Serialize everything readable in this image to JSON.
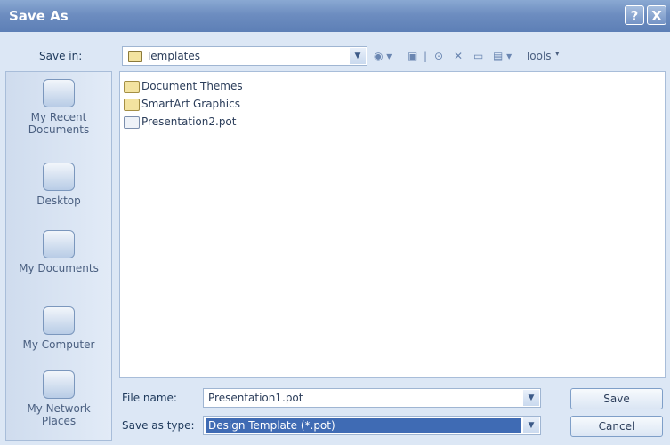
{
  "window": {
    "title": "Save As",
    "help_glyph": "?",
    "close_glyph": "X"
  },
  "toolbar": {
    "save_in_label": "Save in:",
    "save_in_value": "Templates",
    "tools_label": "Tools"
  },
  "places": [
    {
      "label_line1": "My Recent",
      "label_line2": "Documents",
      "icon": "recent-documents-icon"
    },
    {
      "label_line1": "Desktop",
      "label_line2": "",
      "icon": "desktop-icon"
    },
    {
      "label_line1": "My Documents",
      "label_line2": "",
      "icon": "my-documents-icon"
    },
    {
      "label_line1": "My Computer",
      "label_line2": "",
      "icon": "my-computer-icon"
    },
    {
      "label_line1": "My Network",
      "label_line2": "Places",
      "icon": "network-places-icon"
    }
  ],
  "files": [
    {
      "name": "Document Themes",
      "kind": "folder"
    },
    {
      "name": "SmartArt Graphics",
      "kind": "folder"
    },
    {
      "name": "Presentation2.pot",
      "kind": "file"
    }
  ],
  "form": {
    "file_name_label": "File name:",
    "file_name_value": "Presentation1.pot",
    "save_type_label": "Save as type:",
    "save_type_value": "Design Template (*.pot)"
  },
  "buttons": {
    "save": "Save",
    "cancel": "Cancel"
  }
}
